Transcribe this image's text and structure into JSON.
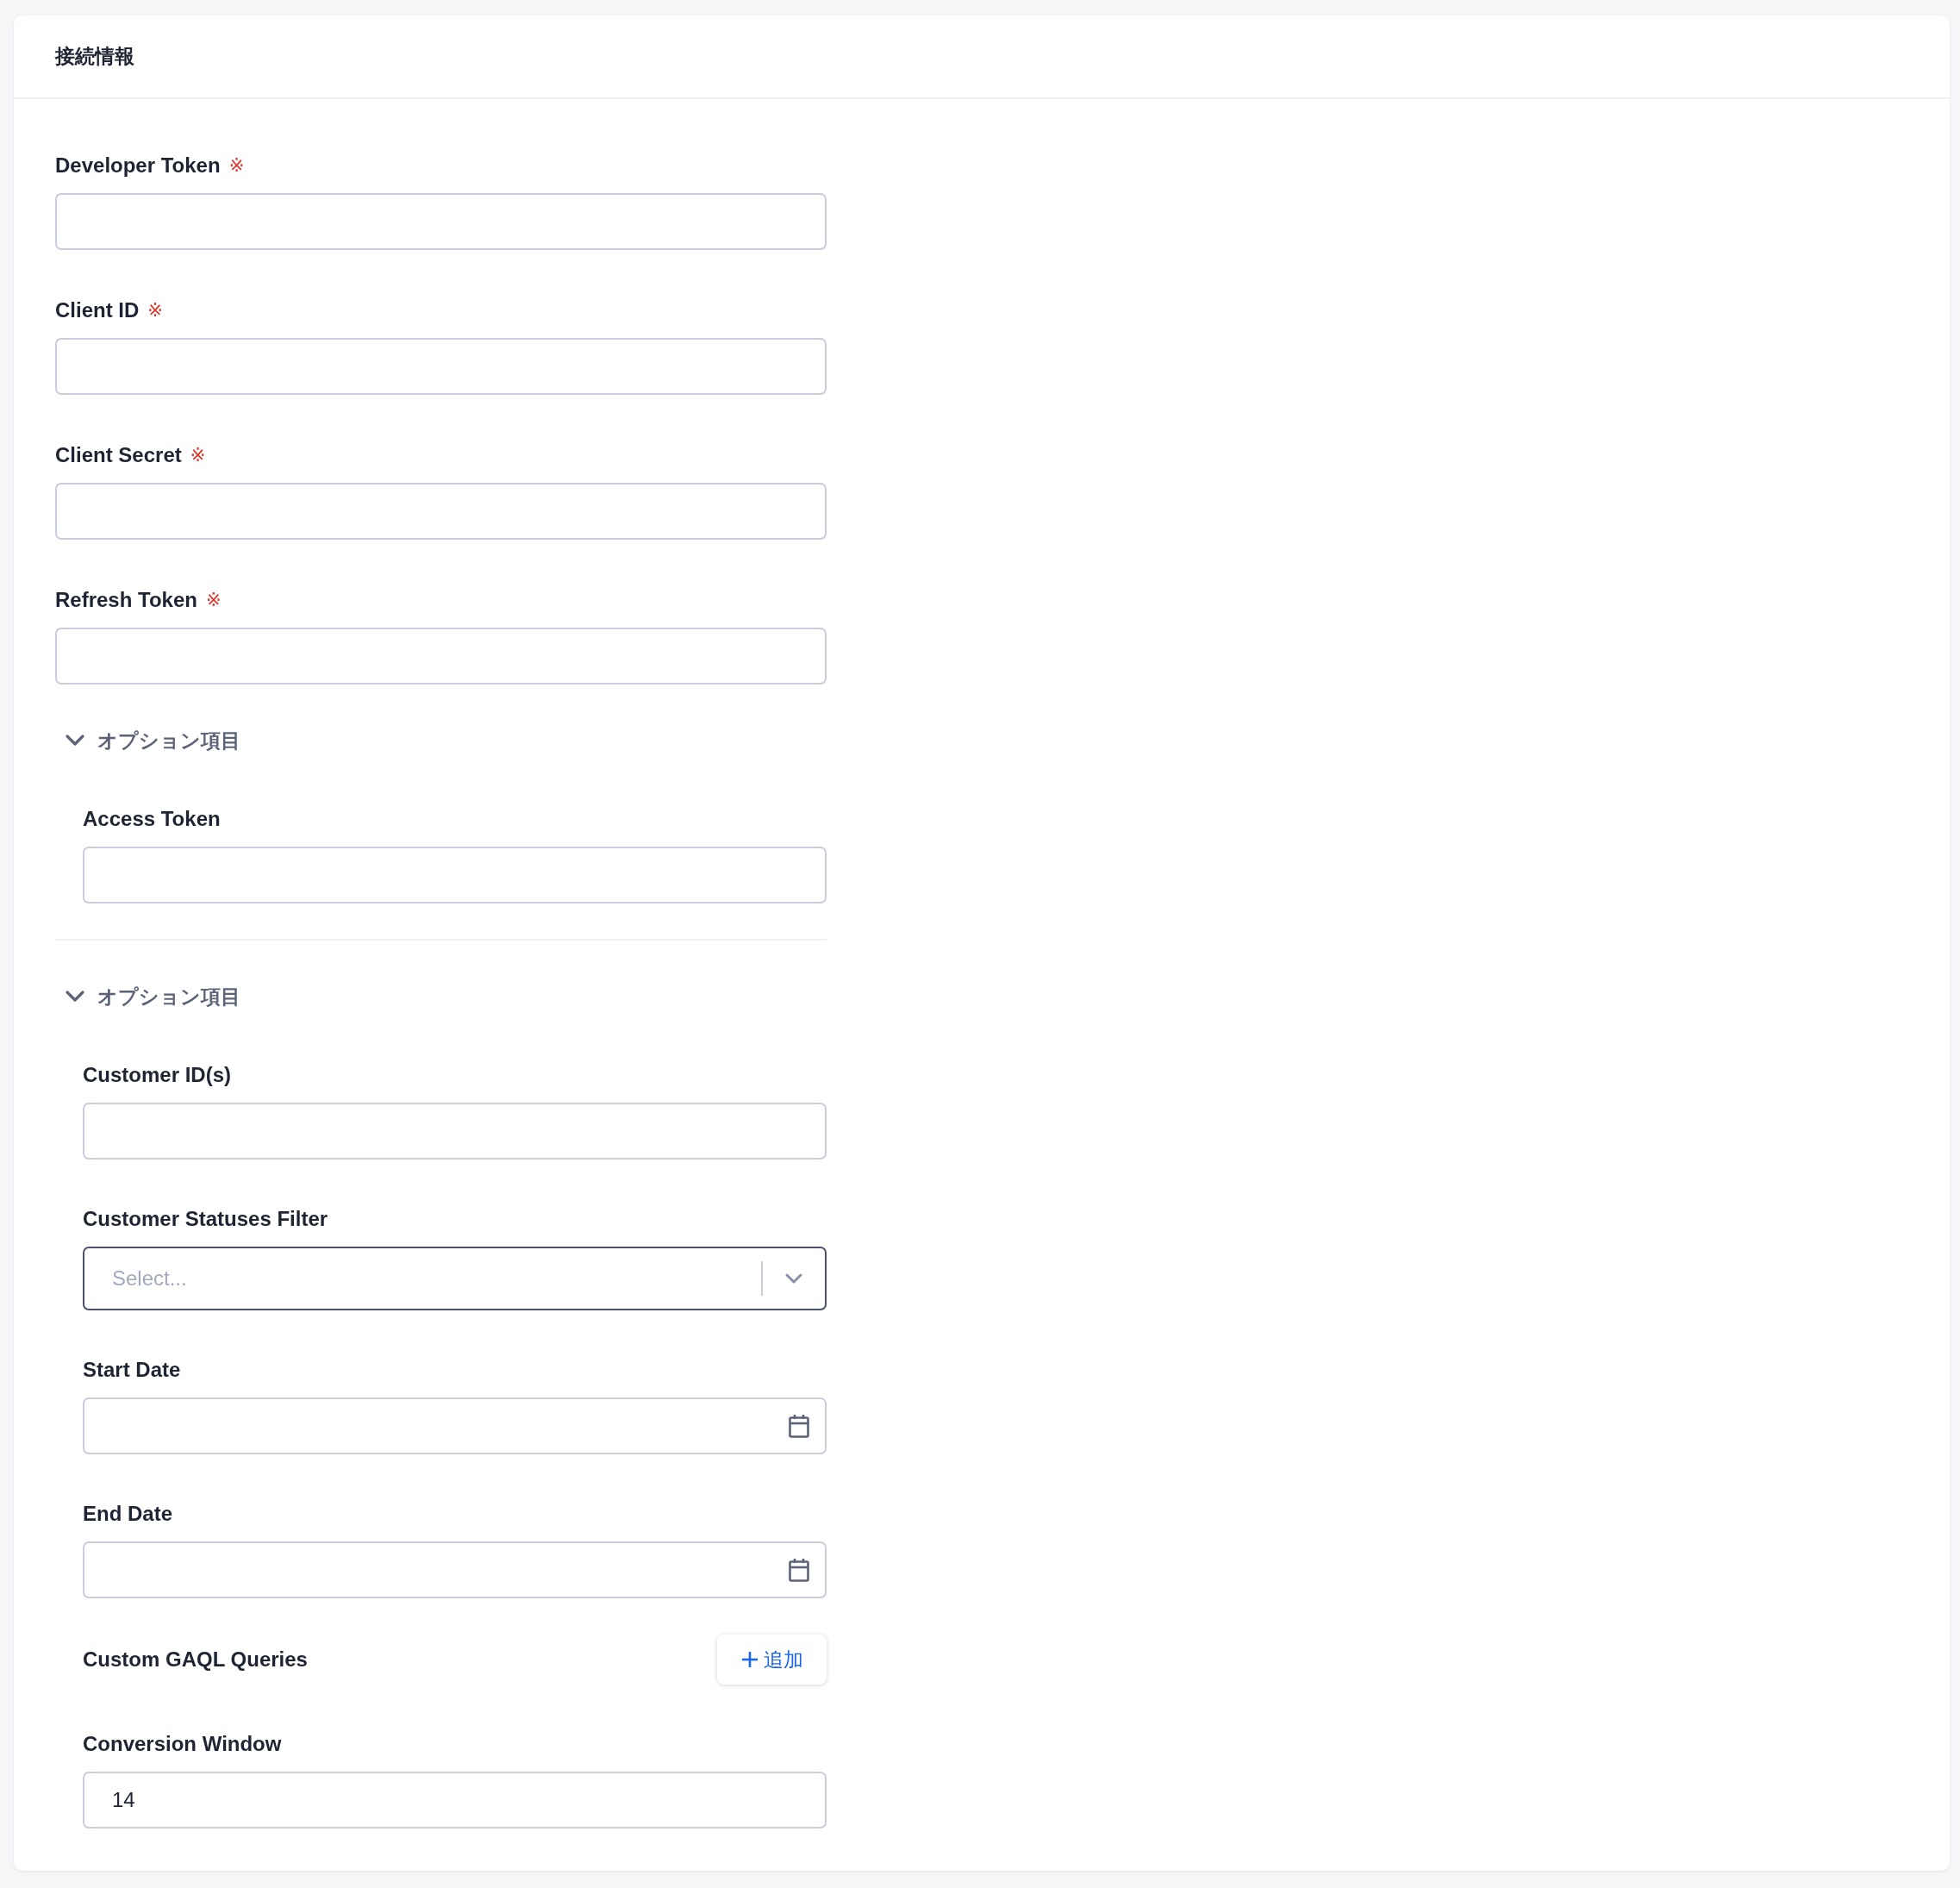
{
  "panel": {
    "title": "接続情報"
  },
  "fields": [
    {
      "kind": "text",
      "label": "Developer Token",
      "required_mark": "※"
    },
    {
      "kind": "text",
      "label": "Client ID",
      "required_mark": "※"
    },
    {
      "kind": "text",
      "label": "Client Secret",
      "required_mark": "※"
    },
    {
      "kind": "text",
      "label": "Refresh Token",
      "required_mark": "※"
    }
  ],
  "option_groups": [
    {
      "title": "オプション項目",
      "expanded": true,
      "fields": [
        {
          "kind": "text",
          "label": "Access Token"
        }
      ]
    },
    {
      "title": "オプション項目",
      "expanded": true,
      "fields": [
        {
          "kind": "text",
          "label": "Customer ID(s)"
        },
        {
          "kind": "select",
          "label": "Customer Statuses Filter",
          "placeholder": "Select...",
          "focused": true
        },
        {
          "kind": "date",
          "label": "Start Date"
        },
        {
          "kind": "date",
          "label": "End Date"
        },
        {
          "kind": "list",
          "label": "Custom GAQL Queries",
          "button": "追加"
        },
        {
          "kind": "text",
          "label": "Conversion Window",
          "value": "14"
        }
      ]
    }
  ]
}
